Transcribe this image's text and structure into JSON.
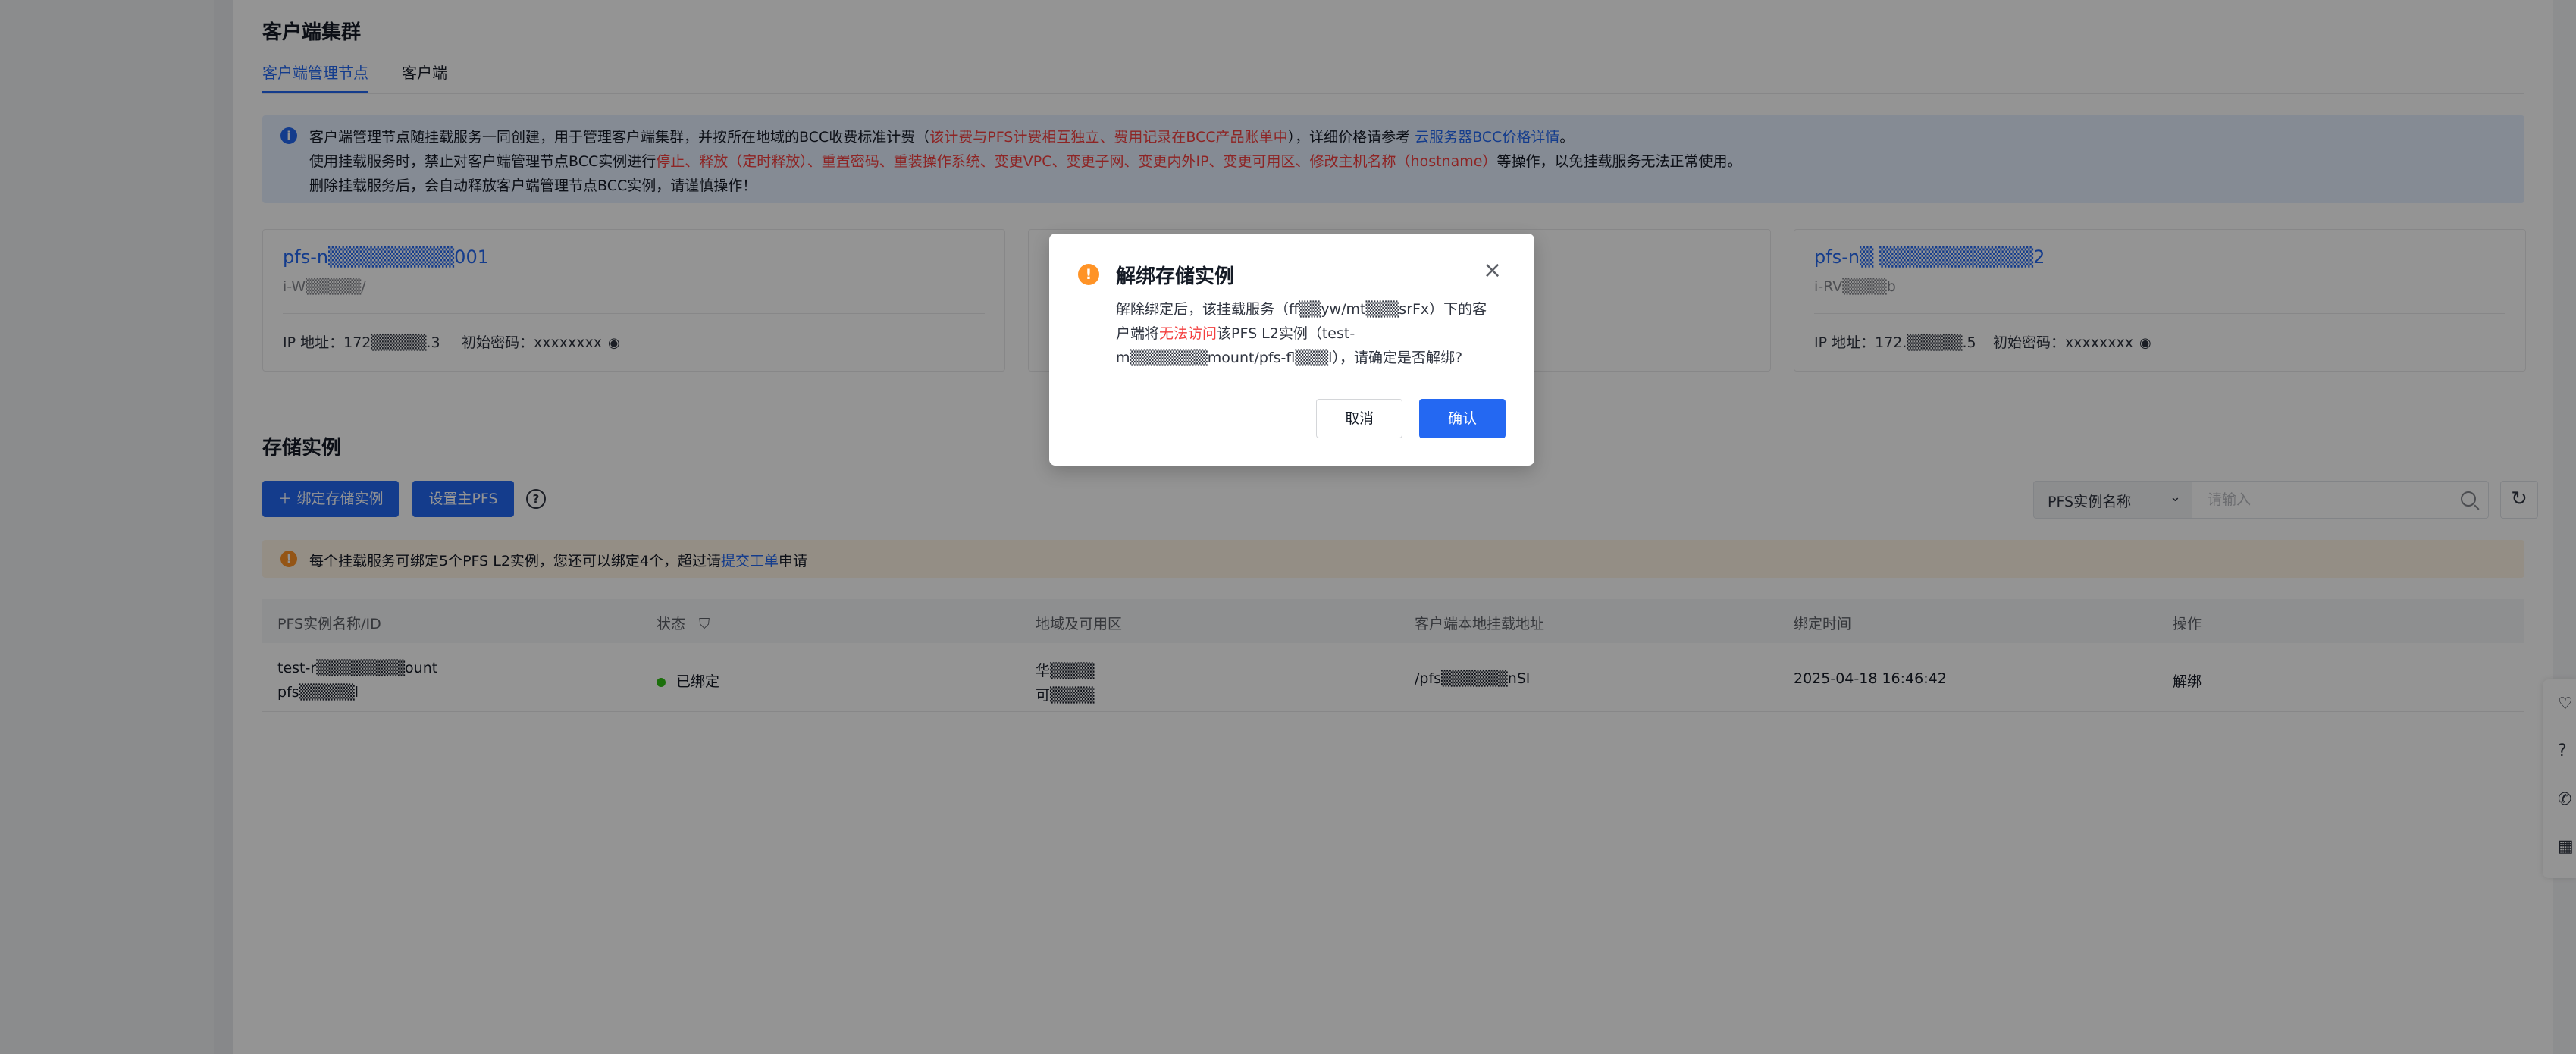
{
  "client_cluster": {
    "title": "客户端集群",
    "tabs": [
      "客户端管理节点",
      "客户端"
    ],
    "notice": {
      "line1_a": "客户端管理节点随挂载服务一同创建，用于管理客户端集群，并按所在地域的BCC收费标准计费（",
      "line1_red": "该计费与PFS计费相互独立、费用记录在BCC产品账单中",
      "line1_b": "），详细价格请参考 ",
      "line1_link": "云服务器BCC价格详情",
      "line1_c": "。",
      "line2_a": "使用挂载服务时，禁止对客户端管理节点BCC实例进行",
      "line2_red": "停止、释放（定时释放）、重置密码、重装操作系统、变更VPC、变更子网、变更内外IP、变更可用区、修改主机名称（hostname）",
      "line2_b": "等操作，以免挂载服务无法正常使用。",
      "line3": "删除挂载服务后，会自动释放客户端管理节点BCC实例，请谨慎操作！"
    },
    "nodes": [
      {
        "name": "pfs-n▒▒▒▒▒▒▒▒▒001",
        "id": "i-W▒▒▒▒▒/",
        "ip_label": "IP 地址：",
        "ip": "172▒▒▒▒▒.3",
        "pwd_label": "初始密码：",
        "pwd": "xxxxxxxx"
      },
      {
        "name": "pfs-n▒ ▒▒▒▒▒▒▒▒▒▒▒2",
        "id": "i-RV▒▒▒▒b",
        "ip_label": "IP 地址：",
        "ip": "172.▒▒▒▒▒.5",
        "pwd_label": "初始密码：",
        "pwd": "xxxxxxxx"
      }
    ]
  },
  "storage": {
    "title": "存储实例",
    "bind_button": "＋ 绑定存储实例",
    "set_main_button": "设置主PFS",
    "filter_select": "PFS实例名称",
    "search_placeholder": "请输入",
    "warn": {
      "text_a": "每个挂载服务可绑定5个PFS L2实例，您还可以绑定4个，超过请",
      "link": "提交工单",
      "text_b": "申请"
    },
    "columns": [
      "PFS实例名称/ID",
      "状态",
      "地域及可用区",
      "客户端本地挂载地址",
      "绑定时间",
      "操作"
    ],
    "rows": [
      {
        "name": "test-r▒▒▒▒▒▒▒▒ount",
        "id": "pfs▒▒▒▒▒l",
        "status": "已绑定",
        "region": "华▒▒▒▒",
        "zone": "可▒▒▒▒",
        "mount": "/pfs▒▒▒▒▒▒nSl",
        "bind_time": "2025-04-18 16:46:42",
        "action": "解绑"
      }
    ]
  },
  "dialog": {
    "title": "解绑存储实例",
    "body_a": "解除绑定后，该挂载服务（ff▒▒yw/mt▒▒▒srFx）下的客户端将",
    "body_red": "无法访问",
    "body_b": "该PFS L2实例（test-m▒▒▒▒▒▒▒mount/pfs-fl▒▒▒l），请确定是否解绑?",
    "cancel": "取消",
    "confirm": "确认"
  },
  "colors": {
    "primary": "#2468f2",
    "danger": "#f33e3e",
    "warning": "#ff9326",
    "success": "#30bf13"
  }
}
